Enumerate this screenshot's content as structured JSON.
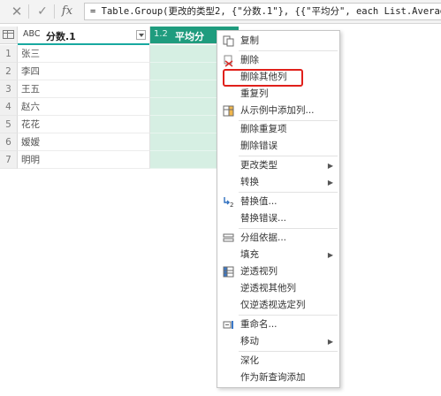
{
  "formula_bar": {
    "close_icon": "close-icon",
    "check_icon": "check-icon",
    "fx_label": "fx",
    "formula": "= Table.Group(更改的类型2, {\"分数.1\"}, {{\"平均分\", each List.Average"
  },
  "columns": [
    {
      "type_label": "ABC",
      "name": "分数.1"
    },
    {
      "type_label": "1.2",
      "name": "平均分"
    }
  ],
  "rows": [
    {
      "num": "1",
      "name": "张三"
    },
    {
      "num": "2",
      "name": "李四"
    },
    {
      "num": "3",
      "name": "王五"
    },
    {
      "num": "4",
      "name": "赵六"
    },
    {
      "num": "5",
      "name": "花花"
    },
    {
      "num": "6",
      "name": "嫒嫒"
    },
    {
      "num": "7",
      "name": "明明"
    }
  ],
  "context_menu": {
    "items": [
      {
        "label": "复制",
        "icon": "copy-icon"
      },
      {
        "label": "删除",
        "icon": "delete-icon"
      },
      {
        "label": "删除其他列"
      },
      {
        "label": "重复列"
      },
      {
        "label": "从示例中添加列...",
        "icon": "add-column-icon"
      },
      {
        "label": "删除重复项"
      },
      {
        "label": "删除错误"
      },
      {
        "label": "更改类型",
        "submenu": true
      },
      {
        "label": "转换",
        "submenu": true
      },
      {
        "label": "替换值...",
        "icon": "replace-icon"
      },
      {
        "label": "替换错误..."
      },
      {
        "label": "分组依据...",
        "icon": "group-icon"
      },
      {
        "label": "填充",
        "submenu": true
      },
      {
        "label": "逆透视列",
        "icon": "unpivot-icon"
      },
      {
        "label": "逆透视其他列"
      },
      {
        "label": "仅逆透视选定列"
      },
      {
        "label": "重命名...",
        "icon": "rename-icon"
      },
      {
        "label": "移动",
        "submenu": true
      },
      {
        "label": "深化"
      },
      {
        "label": "作为新查询添加"
      }
    ],
    "highlighted": "删除其他列",
    "highlight_color": "#e0201b"
  },
  "colors": {
    "selected_header": "#1f9c7e",
    "selected_column": "#d6efe3"
  }
}
